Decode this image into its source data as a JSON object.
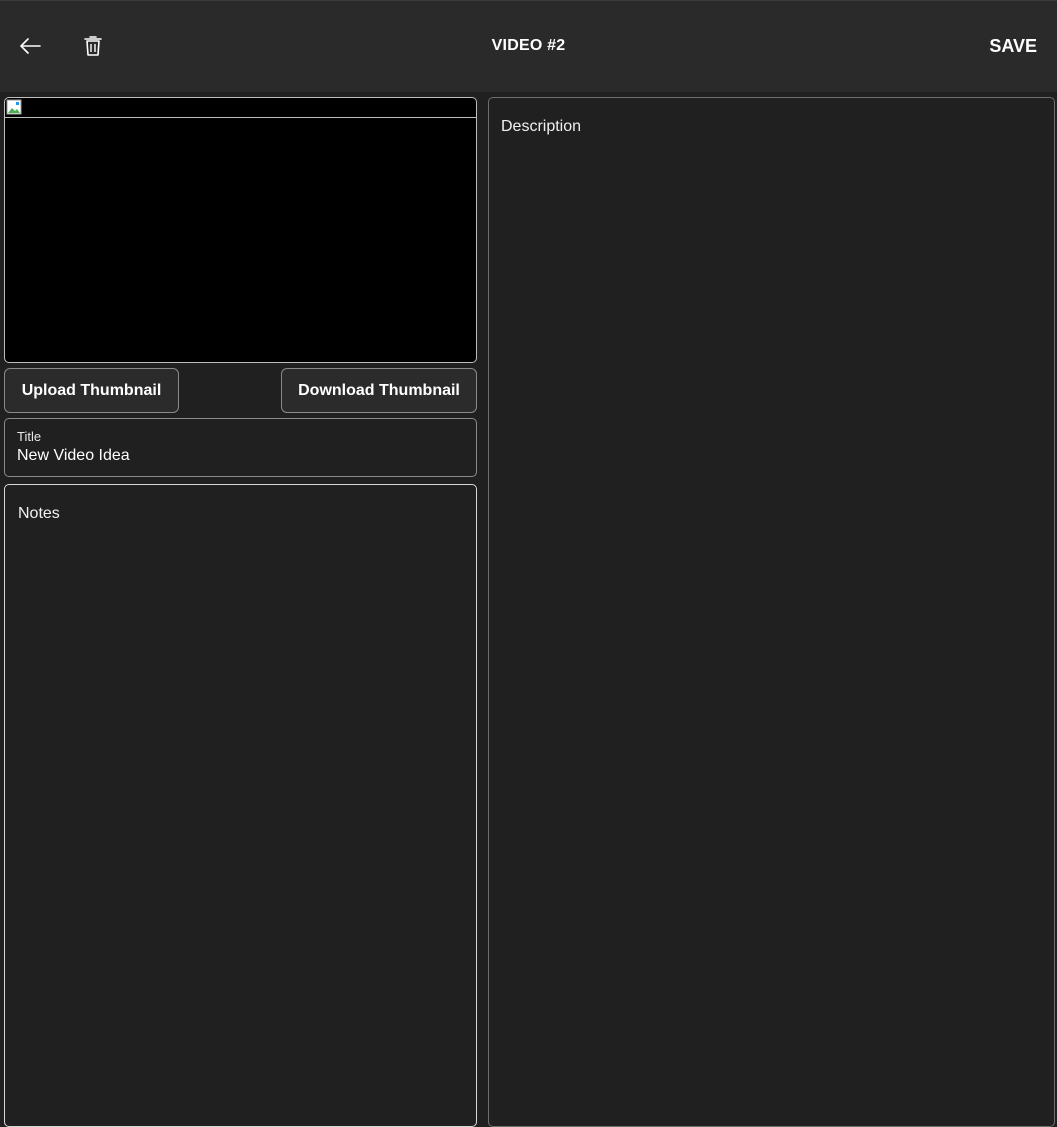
{
  "header": {
    "title": "VIDEO #2",
    "save_label": "SAVE",
    "back_icon": "arrow-left-icon",
    "delete_icon": "trash-icon"
  },
  "thumbnail": {
    "upload_label": "Upload Thumbnail",
    "download_label": "Download Thumbnail"
  },
  "title_field": {
    "label": "Title",
    "value": "New Video Idea"
  },
  "notes_field": {
    "placeholder": "Notes"
  },
  "description_field": {
    "placeholder": "Description"
  },
  "colors": {
    "background": "#202020",
    "header": "#2a2a2a",
    "text": "#ffffff"
  }
}
